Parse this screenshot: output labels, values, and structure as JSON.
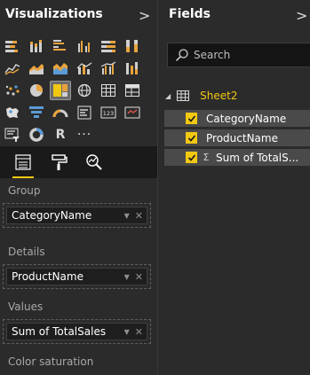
{
  "visualizations": {
    "title": "Visualizations",
    "collapse_glyph": ">",
    "icons": [
      {
        "name": "stacked-bar-chart-icon",
        "selected": false
      },
      {
        "name": "stacked-column-chart-icon",
        "selected": false
      },
      {
        "name": "clustered-bar-chart-icon",
        "selected": false
      },
      {
        "name": "clustered-column-chart-icon",
        "selected": false
      },
      {
        "name": "100-percent-stacked-bar-chart-icon",
        "selected": false
      },
      {
        "name": "100-percent-stacked-column-chart-icon",
        "selected": false
      },
      {
        "name": "line-chart-icon",
        "selected": false
      },
      {
        "name": "area-chart-icon",
        "selected": false
      },
      {
        "name": "stacked-area-chart-icon",
        "selected": false
      },
      {
        "name": "line-and-stacked-column-chart-icon",
        "selected": false
      },
      {
        "name": "line-and-clustered-column-chart-icon",
        "selected": false
      },
      {
        "name": "ribbon-chart-icon",
        "selected": false
      },
      {
        "name": "scatter-chart-icon",
        "selected": false
      },
      {
        "name": "pie-chart-icon",
        "selected": false
      },
      {
        "name": "treemap-icon",
        "selected": true
      },
      {
        "name": "map-icon",
        "selected": false
      },
      {
        "name": "table-icon",
        "selected": false
      },
      {
        "name": "matrix-icon",
        "selected": false
      },
      {
        "name": "filled-map-icon",
        "selected": false
      },
      {
        "name": "funnel-chart-icon",
        "selected": false
      },
      {
        "name": "gauge-icon",
        "selected": false
      },
      {
        "name": "multi-row-card-icon",
        "selected": false
      },
      {
        "name": "card-icon",
        "selected": false
      },
      {
        "name": "kpi-icon",
        "selected": false
      },
      {
        "name": "slicer-icon",
        "selected": false
      },
      {
        "name": "donut-chart-icon",
        "selected": false
      },
      {
        "name": "r-script-visual-icon",
        "glyph": "R",
        "selected": false
      },
      {
        "name": "more-visuals-icon",
        "glyph": "···",
        "selected": false
      }
    ],
    "tools": [
      {
        "name": "fields-tab-icon",
        "active": true
      },
      {
        "name": "format-paint-roller-icon",
        "active": false
      },
      {
        "name": "analytics-magnifier-icon",
        "active": false
      }
    ],
    "wells": [
      {
        "label": "Group",
        "field": "CategoryName"
      },
      {
        "label": "Details",
        "field": "ProductName"
      },
      {
        "label": "Values",
        "field": "Sum of TotalSales"
      }
    ],
    "trailing_label": "Color saturation",
    "dropdown_glyph": "▼",
    "remove_glyph": "✕"
  },
  "fields": {
    "title": "Fields",
    "collapse_glyph": ">",
    "search": {
      "placeholder": "Search",
      "value": ""
    },
    "table": {
      "caret": "◢",
      "name": "Sheet2"
    },
    "items": [
      {
        "name": "CategoryName",
        "checked": true,
        "measure": false
      },
      {
        "name": "ProductName",
        "checked": true,
        "measure": false
      },
      {
        "name": "Sum of TotalS...",
        "checked": true,
        "measure": true,
        "sigma": "Σ"
      }
    ]
  },
  "colors": {
    "accent": "#f2c811",
    "pane_bg": "#2b2b2b",
    "selected_icon_bg": "#6b6b6b"
  }
}
